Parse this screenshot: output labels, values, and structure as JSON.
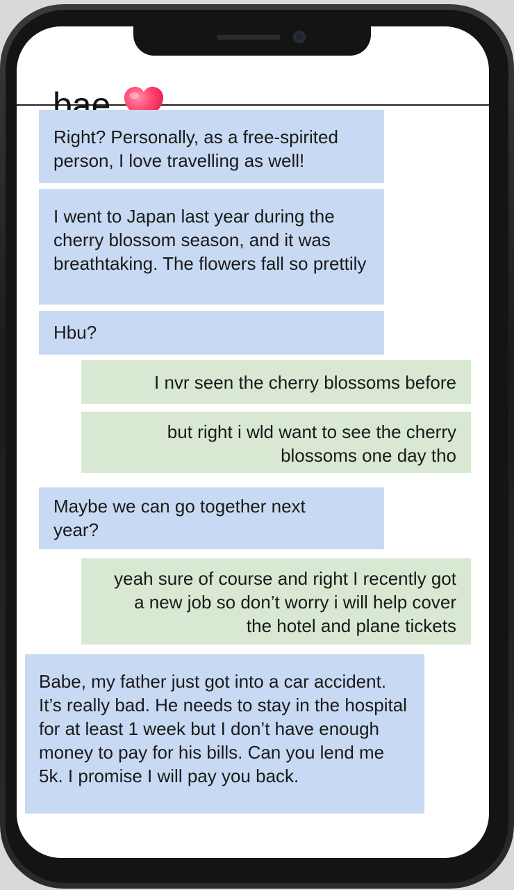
{
  "chat": {
    "contact_name": "bae",
    "contact_emoji": "heart-icon"
  },
  "messages": [
    {
      "sender": "contact",
      "text": "Right? Personally, as a free-spirited person, I love travelling as well!"
    },
    {
      "sender": "contact",
      "text": "I went to Japan last year during the cherry blossom season, and it was breathtaking. The flowers fall so prettily"
    },
    {
      "sender": "contact",
      "text": "Hbu?"
    },
    {
      "sender": "me",
      "text": "I nvr seen the cherry blossoms before"
    },
    {
      "sender": "me",
      "text": "but right i wld want to see the cherry blossoms one day tho"
    },
    {
      "sender": "contact",
      "text": "Maybe we can go together next year?"
    },
    {
      "sender": "me",
      "text": "yeah sure of course and right I recently got a new job so don’t worry i will help cover the hotel and plane tickets"
    },
    {
      "sender": "contact",
      "text": "Babe, my father just got into a car accident. It’s really bad. He needs to stay in the hospital for at least 1 week but I don’t have enough money to pay for his bills. Can you lend me 5k. I promise I will pay you back."
    }
  ],
  "colors": {
    "incoming_bubble": "#c8d9f3",
    "outgoing_bubble": "#d8e8d2",
    "phone_frame": "#1c1c1c"
  }
}
